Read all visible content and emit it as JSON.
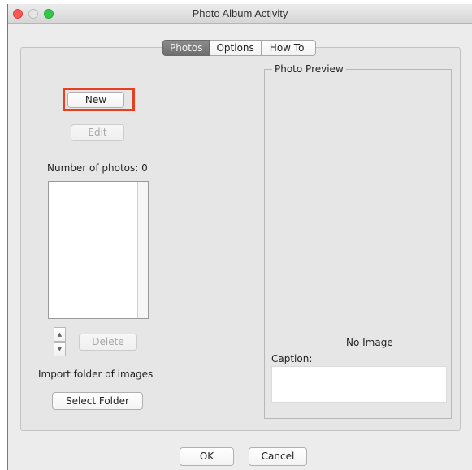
{
  "window": {
    "title": "Photo Album Activity"
  },
  "tabs": [
    {
      "label": "Photos",
      "active": true
    },
    {
      "label": "Options",
      "active": false
    },
    {
      "label": "How To",
      "active": false
    }
  ],
  "photos": {
    "new_label": "New",
    "edit_label": "Edit",
    "count_label": "Number of photos: 0",
    "list_items": [],
    "delete_label": "Delete",
    "import_label": "Import folder of images",
    "select_folder_label": "Select Folder",
    "up_arrow": "▲",
    "down_arrow": "▼"
  },
  "preview": {
    "legend": "Photo Preview",
    "no_image": "No Image",
    "caption_label": "Caption:",
    "caption_value": ""
  },
  "footer": {
    "ok_label": "OK",
    "cancel_label": "Cancel"
  },
  "colors": {
    "highlight": "#e8401f",
    "close": "#fc5753",
    "maximize": "#33c748",
    "active_tab": "#7d7d7d"
  }
}
